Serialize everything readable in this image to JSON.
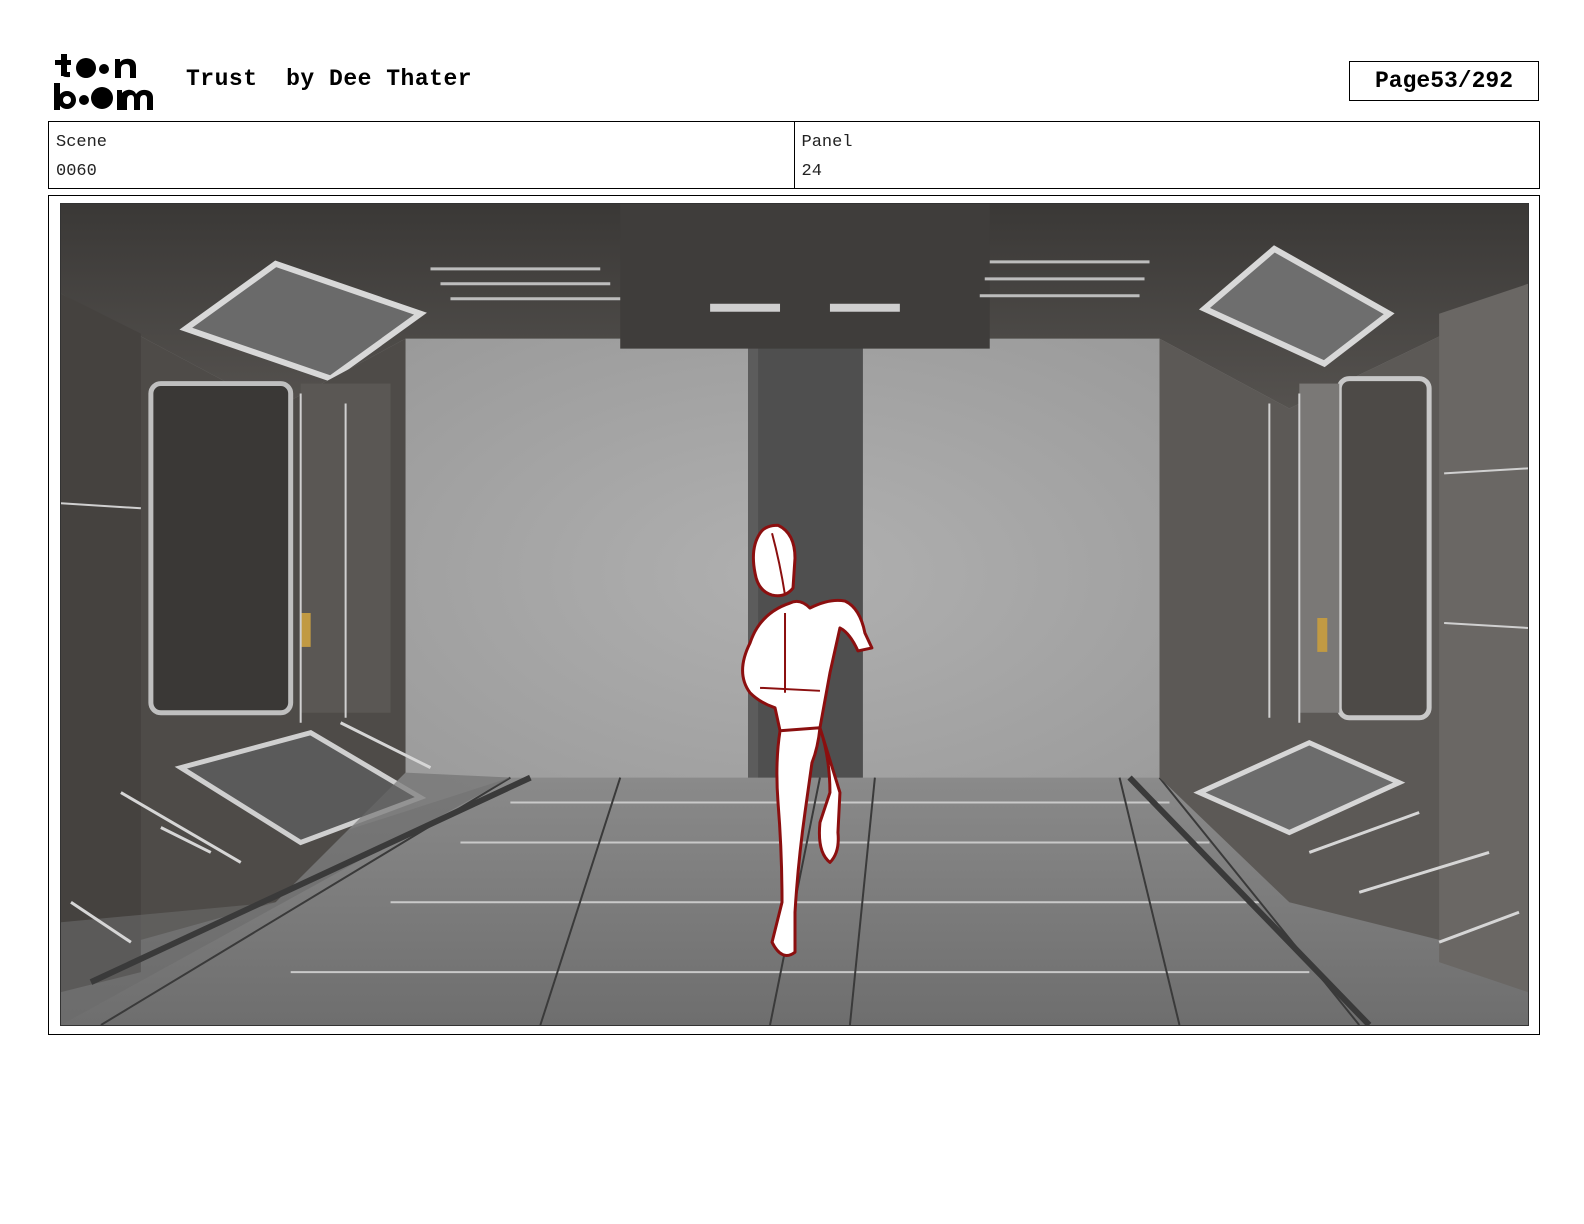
{
  "header": {
    "logo_text": "toon boom",
    "title": "Trust",
    "author": "by Dee Thater",
    "page_label": "Page",
    "page_number": "53/292"
  },
  "info": {
    "scene_label": "Scene",
    "scene_value": "0060",
    "panel_label": "Panel",
    "panel_value": "24"
  },
  "panel": {
    "image_description_icon": "storyboard-panel-image",
    "colors": {
      "sketch_line": "#8b0f0f",
      "background_fog": "#a2a2a2",
      "wall_dark": "#4a4846",
      "floor": "#7c7c7c"
    }
  }
}
